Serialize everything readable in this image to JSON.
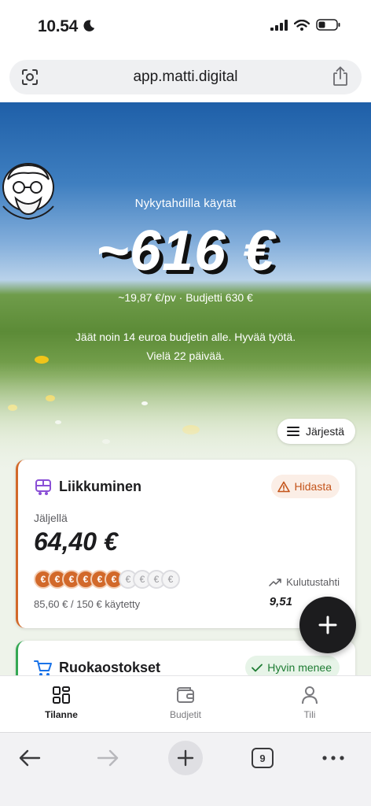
{
  "status": {
    "time": "10.54"
  },
  "browser": {
    "url": "app.matti.digital",
    "tab_count": "9"
  },
  "hero": {
    "subtitle": "Nykytahdilla käytät",
    "amount": "~616 €",
    "meta": "~19,87 €/pv · Budjetti 630 €",
    "message": "Jäät noin 14 euroa budjetin alle. Hyvää työtä. Vielä 22 päivää.",
    "sort_label": "Järjestä"
  },
  "cards": [
    {
      "title": "Liikkuminen",
      "badge": "Hidasta",
      "remaining_label": "Jäljellä",
      "remaining_value": "64,40 €",
      "coins_used": 6,
      "coins_total": 10,
      "coin_symbol": "€",
      "spent": "85,60 € / 150 € käytetty",
      "rate_label": "Kulutustahti",
      "rate_value": "9,51",
      "accent": "#d2692a"
    },
    {
      "title": "Ruokaostokset",
      "badge": "Hyvin menee",
      "accent": "#34a853"
    }
  ],
  "nav": {
    "items": [
      {
        "label": "Tilanne",
        "icon": "dashboard-icon",
        "active": true
      },
      {
        "label": "Budjetit",
        "icon": "wallet-icon",
        "active": false
      },
      {
        "label": "Tili",
        "icon": "person-icon",
        "active": false
      }
    ]
  }
}
